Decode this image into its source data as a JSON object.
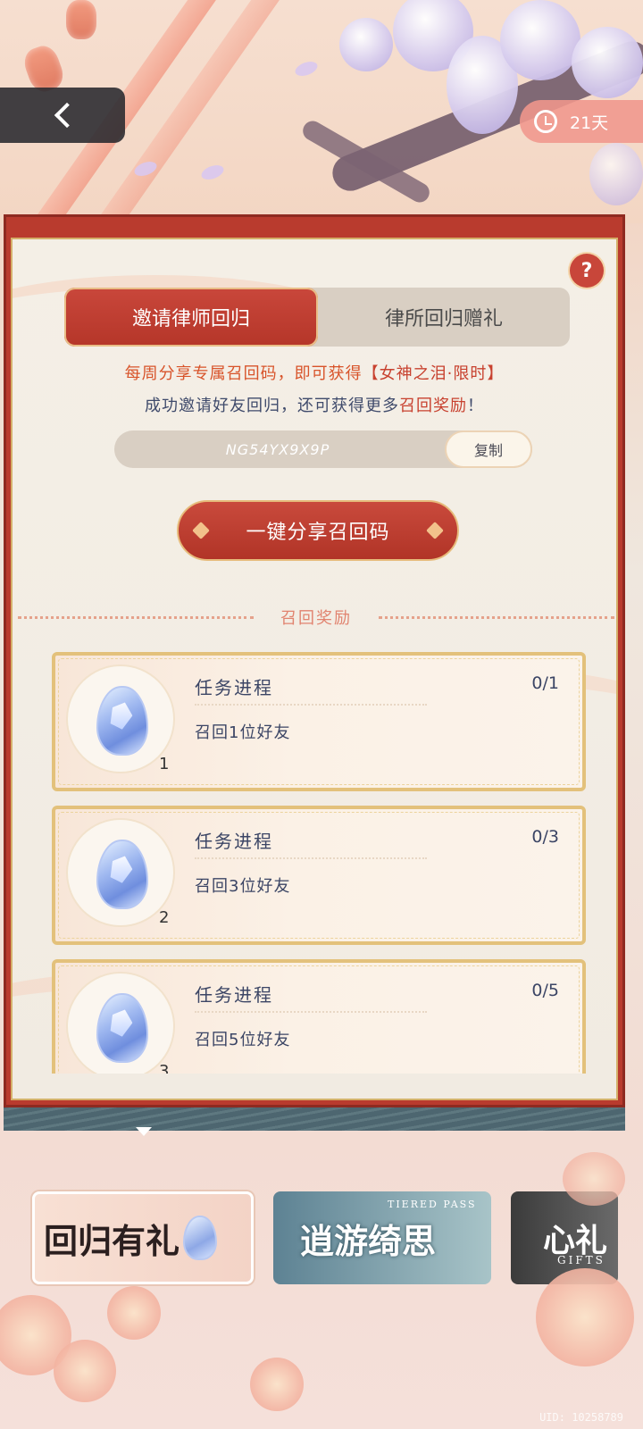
{
  "header": {
    "back_icon": "chevron-left-icon",
    "timer_icon": "clock-icon",
    "days_left": "21天"
  },
  "panel": {
    "help_label": "?",
    "tabs": [
      {
        "label": "邀请律师回归",
        "active": true
      },
      {
        "label": "律所回归赠礼",
        "active": false
      }
    ],
    "info_line1_prefix": "每周分享专属召回码，即可获得",
    "info_line1_highlight": "【女神之泪·限时】",
    "info_line2_prefix": "成功邀请好友回归，还可获得更多",
    "info_line2_highlight": "召回奖励",
    "info_line2_suffix": "！",
    "recall_code": "NG54YX9X9P",
    "copy_label": "复制",
    "share_label": "一键分享召回码",
    "section_title": "召回奖励",
    "rewards": [
      {
        "title": "任务进程",
        "progress": "0/1",
        "desc": "召回1位好友",
        "count": "1"
      },
      {
        "title": "任务进程",
        "progress": "0/3",
        "desc": "召回3位好友",
        "count": "2"
      },
      {
        "title": "任务进程",
        "progress": "0/5",
        "desc": "召回5位好友",
        "count": "3"
      }
    ]
  },
  "carousel": {
    "banners": [
      {
        "title": "回归有礼",
        "sub": ""
      },
      {
        "title": "逍游绮思",
        "sub": "TIERED PASS"
      },
      {
        "title": "心礼",
        "sub": "GIFTS"
      }
    ]
  },
  "footer": {
    "uid": "UID: 10258789"
  },
  "colors": {
    "accent_red": "#b93b2e",
    "panel_bg": "#f4efe6",
    "gold_border": "#d4b06a",
    "text_blue": "#3f4a6b"
  }
}
